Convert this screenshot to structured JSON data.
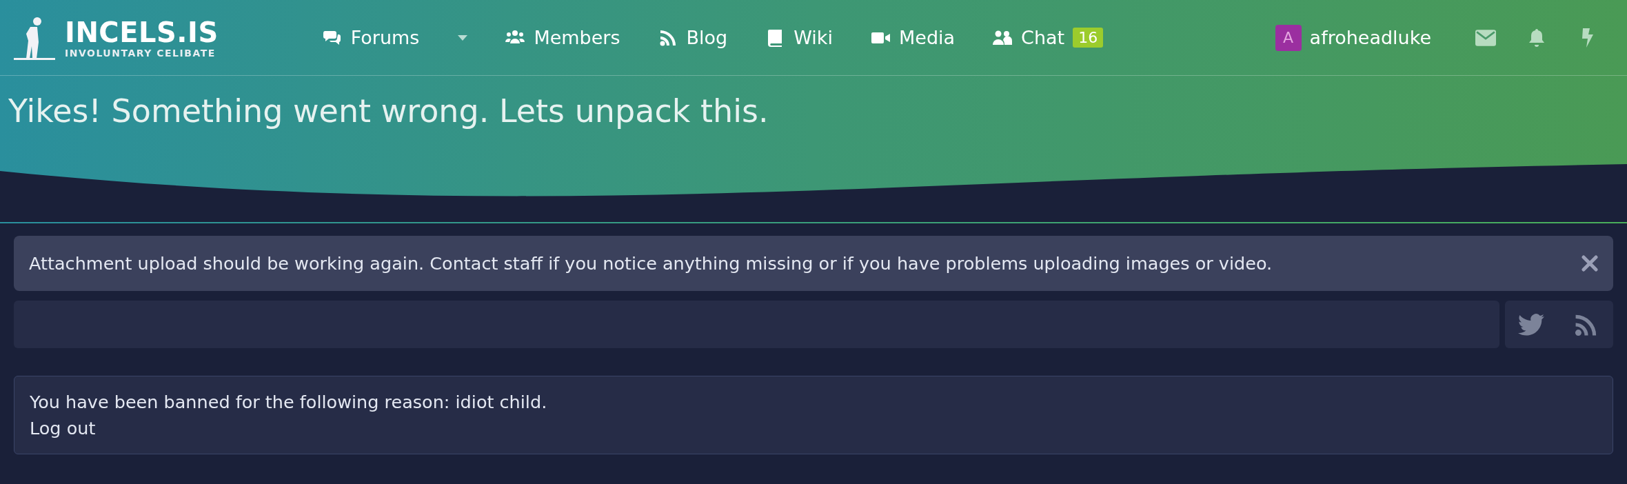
{
  "site": {
    "name": "INCELS.IS",
    "tagline": "INVOLUNTARY CELIBATE"
  },
  "nav": [
    {
      "kind": "forums",
      "label": "Forums",
      "has_menu": true
    },
    {
      "kind": "members",
      "label": "Members",
      "has_menu": false
    },
    {
      "kind": "blog",
      "label": "Blog",
      "has_menu": false
    },
    {
      "kind": "wiki",
      "label": "Wiki",
      "has_menu": false
    },
    {
      "kind": "media",
      "label": "Media",
      "has_menu": false
    },
    {
      "kind": "chat",
      "label": "Chat",
      "has_menu": false,
      "badge": "16"
    }
  ],
  "user": {
    "initial": "A",
    "name": "afroheadluke"
  },
  "page_title": "Yikes! Something went wrong. Lets unpack this.",
  "notice": {
    "text": "Attachment upload should be working again. Contact staff if you notice anything missing or if you have problems uploading images or video."
  },
  "ban": {
    "text": "You have been banned for the following reason: idiot child.",
    "link": "Log out"
  }
}
